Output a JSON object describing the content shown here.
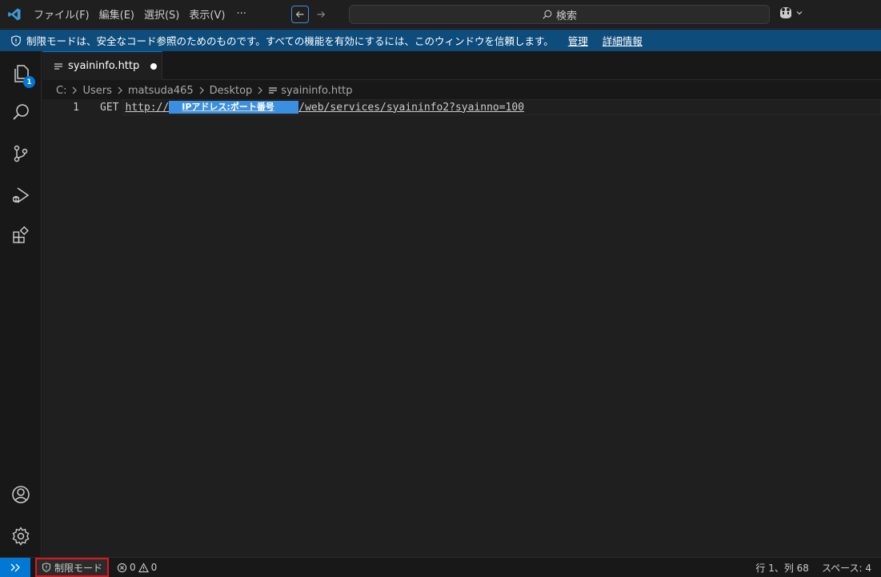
{
  "titlebar": {
    "menus": [
      "ファイル(F)",
      "編集(E)",
      "選択(S)",
      "表示(V)"
    ],
    "more": "···",
    "search_placeholder": "検索"
  },
  "banner": {
    "message": "制限モードは、安全なコード参照のためのものです。すべての機能を有効にするには、このウィンドウを信頼します。",
    "manage_label": "管理",
    "details_label": "詳細情報"
  },
  "activitybar": {
    "explorer_badge": "1"
  },
  "tab": {
    "filename": "syaininfo.http",
    "dirty": true
  },
  "breadcrumb": {
    "parts": [
      "C:",
      "Users",
      "matsuda465",
      "Desktop"
    ],
    "file": "syaininfo.http"
  },
  "editor": {
    "line_number": "1",
    "method": "GET",
    "url_prefix": "http://",
    "redacted_label": "IPアドレス:ポート番号",
    "url_suffix": "/web/services/syaininfo2?syainno=100"
  },
  "statusbar": {
    "restricted_mode": "制限モード",
    "errors": "0",
    "warnings": "0",
    "cursor_position": "行 1、列 68",
    "indent": "スペース: 4"
  },
  "colors": {
    "accent": "#0078d4",
    "banner": "#0e4c7c",
    "highlight": "#e0161e"
  }
}
